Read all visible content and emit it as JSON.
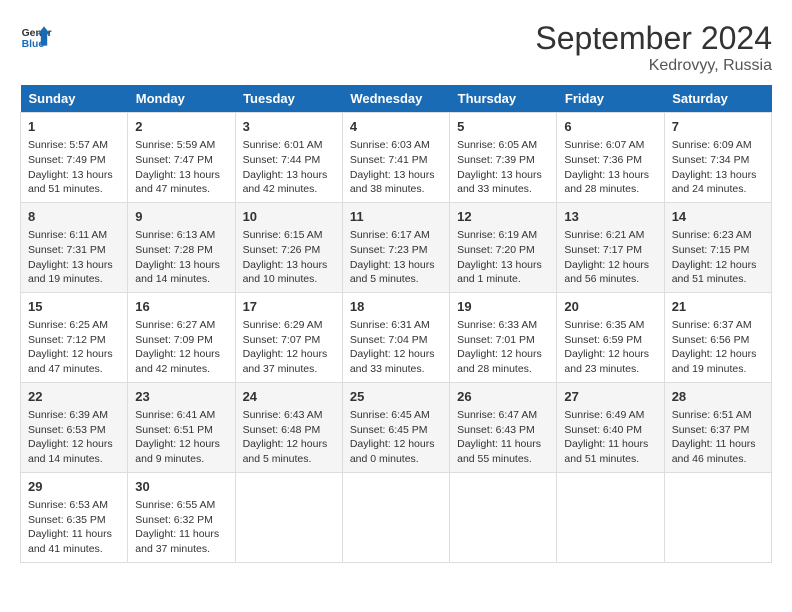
{
  "logo": {
    "line1": "General",
    "line2": "Blue"
  },
  "title": "September 2024",
  "location": "Kedrovyy, Russia",
  "days_header": [
    "Sunday",
    "Monday",
    "Tuesday",
    "Wednesday",
    "Thursday",
    "Friday",
    "Saturday"
  ],
  "weeks": [
    [
      {
        "day": "1",
        "sunrise": "5:57 AM",
        "sunset": "7:49 PM",
        "daylight": "13 hours and 51 minutes."
      },
      {
        "day": "2",
        "sunrise": "5:59 AM",
        "sunset": "7:47 PM",
        "daylight": "13 hours and 47 minutes."
      },
      {
        "day": "3",
        "sunrise": "6:01 AM",
        "sunset": "7:44 PM",
        "daylight": "13 hours and 42 minutes."
      },
      {
        "day": "4",
        "sunrise": "6:03 AM",
        "sunset": "7:41 PM",
        "daylight": "13 hours and 38 minutes."
      },
      {
        "day": "5",
        "sunrise": "6:05 AM",
        "sunset": "7:39 PM",
        "daylight": "13 hours and 33 minutes."
      },
      {
        "day": "6",
        "sunrise": "6:07 AM",
        "sunset": "7:36 PM",
        "daylight": "13 hours and 28 minutes."
      },
      {
        "day": "7",
        "sunrise": "6:09 AM",
        "sunset": "7:34 PM",
        "daylight": "13 hours and 24 minutes."
      }
    ],
    [
      {
        "day": "8",
        "sunrise": "6:11 AM",
        "sunset": "7:31 PM",
        "daylight": "13 hours and 19 minutes."
      },
      {
        "day": "9",
        "sunrise": "6:13 AM",
        "sunset": "7:28 PM",
        "daylight": "13 hours and 14 minutes."
      },
      {
        "day": "10",
        "sunrise": "6:15 AM",
        "sunset": "7:26 PM",
        "daylight": "13 hours and 10 minutes."
      },
      {
        "day": "11",
        "sunrise": "6:17 AM",
        "sunset": "7:23 PM",
        "daylight": "13 hours and 5 minutes."
      },
      {
        "day": "12",
        "sunrise": "6:19 AM",
        "sunset": "7:20 PM",
        "daylight": "13 hours and 1 minute."
      },
      {
        "day": "13",
        "sunrise": "6:21 AM",
        "sunset": "7:17 PM",
        "daylight": "12 hours and 56 minutes."
      },
      {
        "day": "14",
        "sunrise": "6:23 AM",
        "sunset": "7:15 PM",
        "daylight": "12 hours and 51 minutes."
      }
    ],
    [
      {
        "day": "15",
        "sunrise": "6:25 AM",
        "sunset": "7:12 PM",
        "daylight": "12 hours and 47 minutes."
      },
      {
        "day": "16",
        "sunrise": "6:27 AM",
        "sunset": "7:09 PM",
        "daylight": "12 hours and 42 minutes."
      },
      {
        "day": "17",
        "sunrise": "6:29 AM",
        "sunset": "7:07 PM",
        "daylight": "12 hours and 37 minutes."
      },
      {
        "day": "18",
        "sunrise": "6:31 AM",
        "sunset": "7:04 PM",
        "daylight": "12 hours and 33 minutes."
      },
      {
        "day": "19",
        "sunrise": "6:33 AM",
        "sunset": "7:01 PM",
        "daylight": "12 hours and 28 minutes."
      },
      {
        "day": "20",
        "sunrise": "6:35 AM",
        "sunset": "6:59 PM",
        "daylight": "12 hours and 23 minutes."
      },
      {
        "day": "21",
        "sunrise": "6:37 AM",
        "sunset": "6:56 PM",
        "daylight": "12 hours and 19 minutes."
      }
    ],
    [
      {
        "day": "22",
        "sunrise": "6:39 AM",
        "sunset": "6:53 PM",
        "daylight": "12 hours and 14 minutes."
      },
      {
        "day": "23",
        "sunrise": "6:41 AM",
        "sunset": "6:51 PM",
        "daylight": "12 hours and 9 minutes."
      },
      {
        "day": "24",
        "sunrise": "6:43 AM",
        "sunset": "6:48 PM",
        "daylight": "12 hours and 5 minutes."
      },
      {
        "day": "25",
        "sunrise": "6:45 AM",
        "sunset": "6:45 PM",
        "daylight": "12 hours and 0 minutes."
      },
      {
        "day": "26",
        "sunrise": "6:47 AM",
        "sunset": "6:43 PM",
        "daylight": "11 hours and 55 minutes."
      },
      {
        "day": "27",
        "sunrise": "6:49 AM",
        "sunset": "6:40 PM",
        "daylight": "11 hours and 51 minutes."
      },
      {
        "day": "28",
        "sunrise": "6:51 AM",
        "sunset": "6:37 PM",
        "daylight": "11 hours and 46 minutes."
      }
    ],
    [
      {
        "day": "29",
        "sunrise": "6:53 AM",
        "sunset": "6:35 PM",
        "daylight": "11 hours and 41 minutes."
      },
      {
        "day": "30",
        "sunrise": "6:55 AM",
        "sunset": "6:32 PM",
        "daylight": "11 hours and 37 minutes."
      },
      null,
      null,
      null,
      null,
      null
    ]
  ]
}
